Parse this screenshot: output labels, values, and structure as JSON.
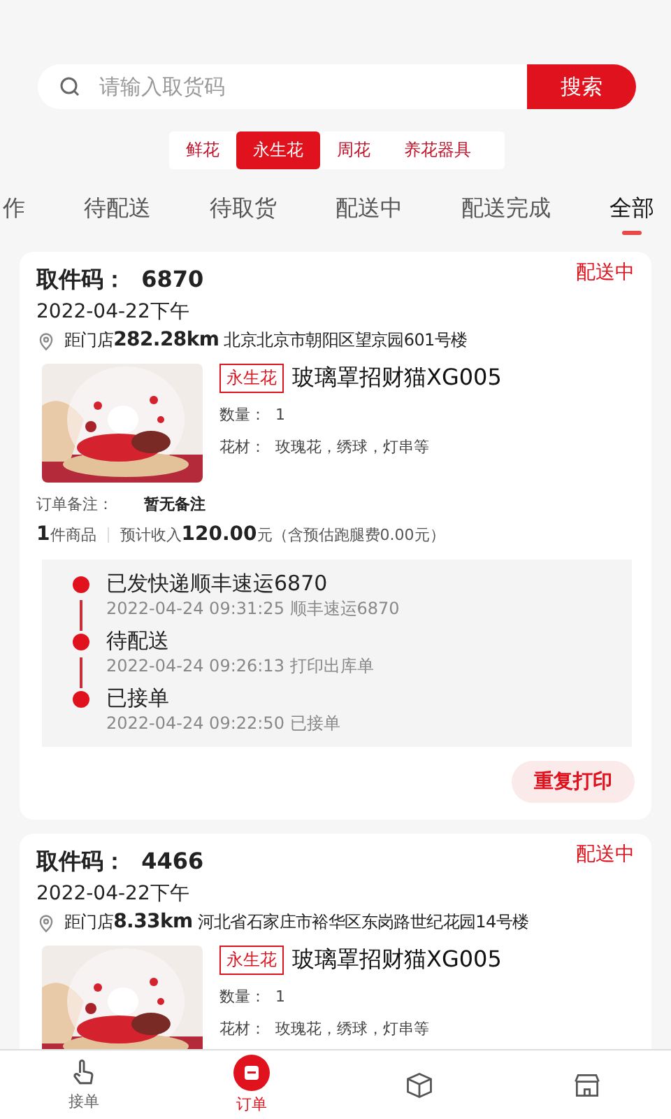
{
  "search": {
    "placeholder": "请输入取货码",
    "button": "搜索"
  },
  "categories": [
    {
      "label": "鲜花",
      "selected": false
    },
    {
      "label": "永生花",
      "selected": true
    },
    {
      "label": "周花",
      "selected": false
    },
    {
      "label": "养花器具",
      "selected": false
    }
  ],
  "status_tabs": [
    {
      "label": "作",
      "selected": false
    },
    {
      "label": "待配送",
      "selected": false
    },
    {
      "label": "待取货",
      "selected": false
    },
    {
      "label": "配送中",
      "selected": false
    },
    {
      "label": "配送完成",
      "selected": false
    },
    {
      "label": "全部",
      "selected": true
    }
  ],
  "orders": [
    {
      "code": "取件码：  6870",
      "status": "配送中",
      "date": "2022-04-22下午",
      "location": "距门店**282.28km** 北京北京市朝阳区望京园601号楼",
      "tag": "永生花",
      "product": "玻璃罩招财猫XG005",
      "quantity": "数量：  1",
      "materials": "花材：  玫瑰花，绣球，灯串等",
      "remark_label": "订单备注：",
      "remark": "暂无备注",
      "count": "**1**件商品",
      "income": "预计收入**120.00**元（含预估跑腿费0.00元）",
      "timeline": [
        {
          "title": "已发快递顺丰速运6870",
          "detail": "2022-04-24 09:31:25 顺丰速运6870"
        },
        {
          "title": "待配送",
          "detail": "2022-04-24 09:26:13 打印出库单"
        },
        {
          "title": "已接单",
          "detail": "2022-04-24 09:22:50 已接单"
        }
      ],
      "button": "重复打印"
    },
    {
      "code": "取件码：  4466",
      "status": "配送中",
      "date": "2022-04-22下午",
      "location": "距门店**8.33km** 河北省石家庄市裕华区东岗路世纪花园14号楼",
      "tag": "永生花",
      "product": "玻璃罩招财猫XG005",
      "quantity": "数量：  1",
      "materials": "花材：  玫瑰花，绣球，灯串等"
    }
  ],
  "bottom_nav": [
    {
      "kind": "hand",
      "label": "接单",
      "selected": false
    },
    {
      "kind": "order",
      "label": "订单",
      "selected": true
    },
    {
      "kind": "box",
      "selected": false
    },
    {
      "kind": "shop",
      "selected": false
    }
  ]
}
